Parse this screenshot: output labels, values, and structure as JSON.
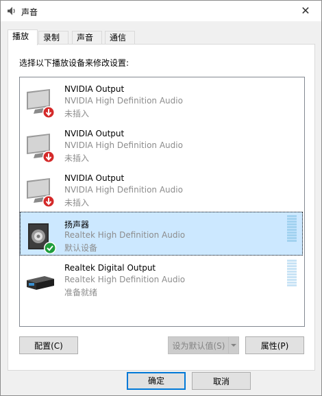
{
  "window": {
    "title": "声音",
    "close_glyph": "✕"
  },
  "tabs": [
    {
      "label": "播放",
      "active": true
    },
    {
      "label": "录制"
    },
    {
      "label": "声音"
    },
    {
      "label": "通信"
    }
  ],
  "instruction": "选择以下播放设备来修改设置:",
  "devices": [
    {
      "name": "NVIDIA Output",
      "description": "NVIDIA High Definition Audio",
      "status": "未插入",
      "icon": "monitor-icon",
      "badge": "unplugged-badge-icon"
    },
    {
      "name": "NVIDIA Output",
      "description": "NVIDIA High Definition Audio",
      "status": "未插入",
      "icon": "monitor-icon",
      "badge": "unplugged-badge-icon"
    },
    {
      "name": "NVIDIA Output",
      "description": "NVIDIA High Definition Audio",
      "status": "未插入",
      "icon": "monitor-icon",
      "badge": "unplugged-badge-icon"
    },
    {
      "name": "扬声器",
      "description": "Realtek High Definition Audio",
      "status": "默认设备",
      "icon": "speaker-icon",
      "badge": "default-check-icon",
      "selected": true
    },
    {
      "name": "Realtek Digital Output",
      "description": "Realtek High Definition Audio",
      "status": "准备就绪",
      "icon": "digital-output-icon"
    }
  ],
  "buttons": {
    "configure": "配置(C)",
    "set_default": "设为默认值(S)",
    "properties": "属性(P)",
    "ok": "确定",
    "cancel": "取消"
  },
  "colors": {
    "selection": "#cce8ff",
    "accent": "#0078d7",
    "meter_active": "#a2d2f0",
    "meter_idle": "#c8e3f5"
  }
}
